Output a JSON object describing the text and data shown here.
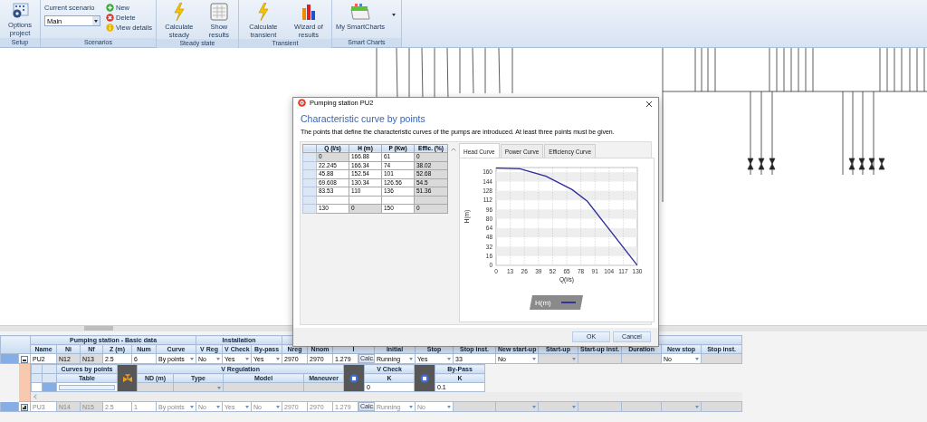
{
  "ribbon": {
    "groups": [
      {
        "kind": "buttons",
        "label": "Setup",
        "buttons": [
          {
            "label": "Options project"
          }
        ]
      },
      {
        "kind": "scenario",
        "label": "Scenarios",
        "caption": "Current scenario",
        "value": "Main",
        "actions": [
          "New",
          "Delete",
          "View details"
        ]
      },
      {
        "kind": "buttons",
        "label": "Steady state",
        "buttons": [
          {
            "label": "Calculate steady"
          },
          {
            "label": "Show results"
          }
        ]
      },
      {
        "kind": "buttons",
        "label": "Transient",
        "buttons": [
          {
            "label": "Calculate transient"
          },
          {
            "label": "Wizard of results"
          }
        ]
      },
      {
        "kind": "buttons",
        "label": "Smart Charts",
        "buttons": [
          {
            "label": "My SmartCharts",
            "menu": true
          }
        ]
      }
    ]
  },
  "dialog": {
    "title": "Pumping station PU2",
    "heading": "Characteristic curve by points",
    "description": "The points that define the characteristic curves of the pumps are introduced. At least three points must be given.",
    "points_table": {
      "columns": [
        "Q (l/s)",
        "H (m)",
        "P (Kw)",
        "Effic. (%)"
      ],
      "rows": [
        {
          "cells": [
            {
              "text": "0",
              "readonly": true
            },
            {
              "text": "166.88",
              "readonly": false
            },
            {
              "text": "61",
              "readonly": false
            },
            {
              "text": "0",
              "readonly": true
            }
          ]
        },
        {
          "cells": [
            {
              "text": "22.245",
              "readonly": false
            },
            {
              "text": "166.34",
              "readonly": false
            },
            {
              "text": "74",
              "readonly": false
            },
            {
              "text": "38.02",
              "readonly": true
            }
          ]
        },
        {
          "cells": [
            {
              "text": "45.88",
              "readonly": false
            },
            {
              "text": "152.54",
              "readonly": false
            },
            {
              "text": "101",
              "readonly": false
            },
            {
              "text": "52.68",
              "readonly": true
            }
          ]
        },
        {
          "cells": [
            {
              "text": "69.608",
              "readonly": false
            },
            {
              "text": "130.34",
              "readonly": false
            },
            {
              "text": "126.56",
              "readonly": false
            },
            {
              "text": "54.5",
              "readonly": true
            }
          ]
        },
        {
          "cells": [
            {
              "text": "83.53",
              "readonly": false
            },
            {
              "text": "110",
              "readonly": false
            },
            {
              "text": "136",
              "readonly": false
            },
            {
              "text": "51.36",
              "readonly": true
            }
          ]
        },
        {
          "cells": [
            {
              "readonly": false
            },
            {
              "readonly": false
            },
            {
              "readonly": false
            },
            {
              "readonly": true
            }
          ]
        },
        {
          "cells": [
            {
              "text": "130",
              "readonly": false
            },
            {
              "text": "0",
              "readonly": true
            },
            {
              "text": "150",
              "readonly": false
            },
            {
              "text": "0",
              "readonly": true
            }
          ]
        }
      ]
    },
    "tabs": [
      {
        "label": "Head Curve",
        "selected": true
      },
      {
        "label": "Power Curve",
        "selected": false
      },
      {
        "label": "Efficiency Curve",
        "selected": false
      }
    ],
    "chart_data": {
      "type": "line",
      "xlabel": "Q(l/s)",
      "ylabel": "H(m)",
      "x": [
        0,
        22,
        46,
        70,
        84,
        130
      ],
      "series": [
        {
          "name": "H(m)",
          "color": "#2b2b9a",
          "values": [
            167,
            166,
            153,
            130,
            110,
            0
          ]
        }
      ],
      "xlim": [
        0,
        130
      ],
      "ylim": [
        0,
        168
      ],
      "grid": true,
      "xticks": [
        0,
        13,
        26,
        39,
        52,
        65,
        78,
        91,
        104,
        117,
        130
      ],
      "yticks": [
        0,
        16,
        32,
        48,
        64,
        80,
        96,
        112,
        128,
        144,
        160
      ]
    },
    "buttons": [
      "OK",
      "Cancel"
    ]
  },
  "grid": {
    "column_groups": [
      {
        "label": "Pumping station - Basic data",
        "columns": [
          "Name",
          "Ni",
          "Nf",
          "Z (m)",
          "Num",
          "Curve"
        ]
      },
      {
        "label": "Installation",
        "columns": [
          "V Reg",
          "V Check",
          "By-pass"
        ]
      },
      {
        "columns": [
          "Nreg",
          "Nnom",
          "I",
          "Initial",
          "Stop",
          "Stop inst.",
          "New start-up",
          "Start-up",
          "Start-up inst.",
          "Duration",
          "New stop",
          "Stop inst."
        ]
      }
    ],
    "rows": [
      {
        "expanded": true,
        "disabled": false,
        "cells": [
          {
            "kind": "text",
            "text": "PU2",
            "readonly": false
          },
          {
            "kind": "text",
            "text": "N12",
            "readonly": true
          },
          {
            "kind": "text",
            "text": "N13",
            "readonly": true
          },
          {
            "kind": "text",
            "text": "2.5",
            "readonly": false
          },
          {
            "kind": "text",
            "text": "6",
            "readonly": false
          },
          {
            "kind": "select",
            "text": "By points",
            "readonly": false
          },
          {
            "kind": "select",
            "text": "No",
            "readonly": false
          },
          {
            "kind": "select",
            "text": "Yes",
            "readonly": false
          },
          {
            "kind": "select",
            "text": "Yes",
            "readonly": false
          },
          {
            "kind": "text",
            "text": "2970",
            "readonly": false
          },
          {
            "kind": "text",
            "text": "2970",
            "readonly": false
          },
          {
            "kind": "calc",
            "text": "1.279",
            "button": "Calc.",
            "readonly": false
          },
          {
            "kind": "select",
            "text": "Running",
            "readonly": false
          },
          {
            "kind": "select",
            "text": "Yes",
            "readonly": false
          },
          {
            "kind": "text",
            "text": "33",
            "readonly": false
          },
          {
            "kind": "select",
            "text": "No",
            "readonly": false
          },
          {
            "kind": "select",
            "readonly": true
          },
          {
            "kind": "text",
            "readonly": true
          },
          {
            "kind": "text",
            "readonly": true
          },
          {
            "kind": "select",
            "text": "No",
            "readonly": false
          },
          {
            "kind": "text",
            "readonly": true
          }
        ]
      },
      {
        "expanded": false,
        "disabled": true,
        "cells": [
          {
            "kind": "text",
            "text": "PU3",
            "readonly": false
          },
          {
            "kind": "text",
            "text": "N14",
            "readonly": true
          },
          {
            "kind": "text",
            "text": "N15",
            "readonly": true
          },
          {
            "kind": "text",
            "text": "2.5",
            "readonly": false
          },
          {
            "kind": "text",
            "text": "1",
            "readonly": false
          },
          {
            "kind": "select",
            "text": "By points",
            "readonly": false
          },
          {
            "kind": "select",
            "text": "No",
            "readonly": false
          },
          {
            "kind": "select",
            "text": "Yes",
            "readonly": false
          },
          {
            "kind": "select",
            "text": "No",
            "readonly": false
          },
          {
            "kind": "text",
            "text": "2970",
            "readonly": false
          },
          {
            "kind": "text",
            "text": "2970",
            "readonly": false
          },
          {
            "kind": "calc",
            "text": "1.279",
            "button": "Calc.",
            "readonly": false
          },
          {
            "kind": "select",
            "text": "Running",
            "readonly": false
          },
          {
            "kind": "select",
            "text": "No",
            "readonly": false
          },
          {
            "kind": "text",
            "readonly": true
          },
          {
            "kind": "select",
            "readonly": true
          },
          {
            "kind": "select",
            "readonly": true
          },
          {
            "kind": "text",
            "readonly": true
          },
          {
            "kind": "text",
            "readonly": true
          },
          {
            "kind": "select",
            "readonly": true
          },
          {
            "kind": "text",
            "readonly": true
          }
        ]
      }
    ],
    "detail": {
      "curves": {
        "label": "Curves by points",
        "column": "Table"
      },
      "regulation": {
        "label": "V Regulation",
        "columns": [
          "ND (m)",
          "Type",
          "Model",
          "Maneuver"
        ]
      },
      "v_check": {
        "label": "V Check",
        "column": "K",
        "value": "0"
      },
      "by_pass": {
        "label": "By-Pass",
        "column": "K",
        "value": "0.1"
      }
    }
  }
}
